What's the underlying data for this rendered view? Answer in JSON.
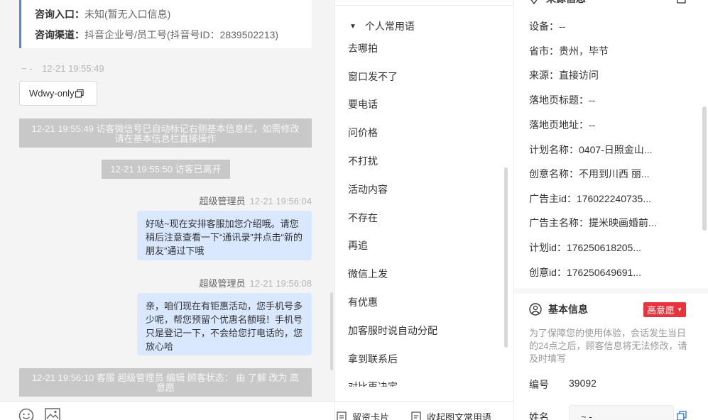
{
  "chat": {
    "info_card": {
      "entry_label": "咨询入口：",
      "entry_value": "未知(暂无入口信息)",
      "channel_label": "咨询渠道：",
      "channel_value": "抖音企业号/员工号(抖音号ID：2839502213)"
    },
    "visitor_name": "~ -",
    "visitor_time": "12-21 19:55:49",
    "visitor_chip": "Wdwy-only",
    "system_msgs": [
      "12-21 19:55:49 访客微信号已自动标记右侧基本信息栏，如需修改请在基本信息栏直接操作",
      "12-21 19:55:50 访客已离开",
      "12-21 19:56:10 客服 超级管理员 编辑 顾客状态： 由 了解 改为 高意愿"
    ],
    "messages": [
      {
        "sender": "超级管理员",
        "time": "12-21 19:56:04",
        "text": "好哒~现在安排客服加您介绍哦。请您稍后注意查看一下“通讯录”并点击“新的朋友”通过下哦"
      },
      {
        "sender": "超级管理员",
        "time": "12-21 19:56:08",
        "text": "亲，咱们现在有钜惠活动，您手机号多少呢，帮您预留个优惠名额哦！手机号只是登记一下，不会给您打电话的，您放心哈"
      }
    ]
  },
  "phrases": {
    "group_label": "个人常用语",
    "items": [
      "去哪拍",
      "窗口发不了",
      "要电话",
      "问价格",
      "不打扰",
      "活动内容",
      "不存在",
      "再追",
      "微信上发",
      "有优惠",
      "加客服时说自动分配",
      "拿到联系后",
      "对比再决定"
    ],
    "footer_card": "留资卡片",
    "footer_collapse": "收起图文常用语"
  },
  "info": {
    "source_section_title": "来源信息",
    "fields": [
      {
        "label": "设备：",
        "value": "--"
      },
      {
        "label": "省市：",
        "value": "贵州，毕节"
      },
      {
        "label": "来源：",
        "value": "直接访问"
      },
      {
        "label": "落地页标题：",
        "value": "--"
      },
      {
        "label": "落地页地址：",
        "value": "--"
      },
      {
        "label": "计划名称：",
        "value": "0407-日照金山..."
      },
      {
        "label": "创意名称：",
        "value": "不用到川西 丽..."
      },
      {
        "label": "广告主id：",
        "value": "176022240735..."
      },
      {
        "label": "广告主名称：",
        "value": "提米映画婚前..."
      },
      {
        "label": "计划id：",
        "value": "176250618205..."
      },
      {
        "label": "创意id：",
        "value": "176250649691..."
      }
    ],
    "basic_title": "基本信息",
    "intent_badge": "高意愿",
    "basic_note": "为了保障您的使用体验，会话发生当日的24点之后，顾客信息将无法修改，请及时填写",
    "id_label": "编号",
    "id_value": "39092",
    "name_label": "姓名",
    "name_value": "~ -"
  },
  "colors": {
    "accent_blue": "#4a8af0",
    "bubble_bg": "#d9e8ff",
    "system_msg_bg": "#c8c8c8",
    "badge_red": "#e8323c"
  }
}
